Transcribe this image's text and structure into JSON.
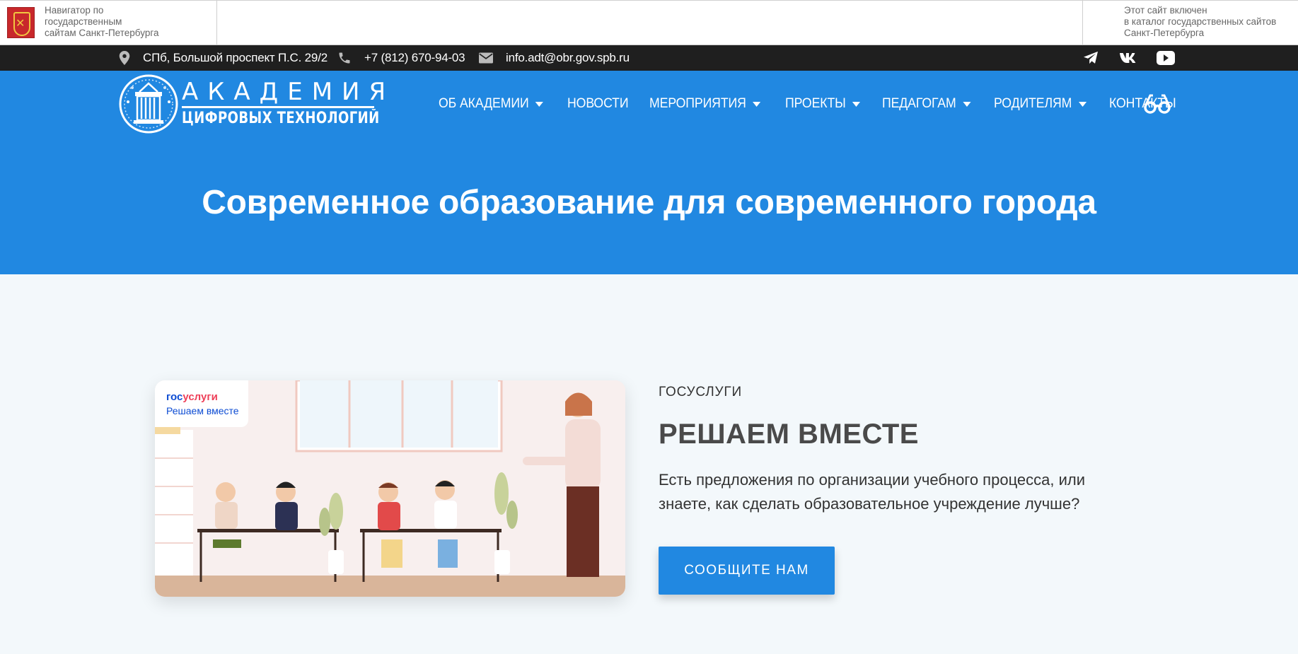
{
  "gov_banner": {
    "left_text": "Навигатор по\nгосударственным\nсайтам Санкт-Петербурга",
    "right_text": "Этот сайт включен\nв каталог государственных сайтов\nСанкт-Петербурга"
  },
  "contacts": {
    "address": "СПб, Большой проспект П.С. 29/2",
    "phone": "+7 (812) 670-94-03",
    "email": "info.adt@obr.gov.spb.ru",
    "social": [
      "telegram-icon",
      "vk-icon",
      "youtube-icon"
    ]
  },
  "logo": {
    "title": "АКАДЕМИЯ",
    "subtitle": "ЦИФРОВЫХ ТЕХНОЛОГИЙ"
  },
  "nav": [
    {
      "label": "ОБ АКАДЕМИИ",
      "dropdown": true
    },
    {
      "label": "НОВОСТИ",
      "dropdown": false
    },
    {
      "label": "МЕРОПРИЯТИЯ",
      "dropdown": true
    },
    {
      "label": "ПРОЕКТЫ",
      "dropdown": true
    },
    {
      "label": "ПЕДАГОГАМ",
      "dropdown": true
    },
    {
      "label": "РОДИТЕЛЯМ",
      "dropdown": true
    },
    {
      "label": "КОНТАКТЫ",
      "dropdown": false
    }
  ],
  "hero": {
    "title": "Современное образование для современного города"
  },
  "gosuslugi": {
    "badge_part1": "гос",
    "badge_part2": "услуги",
    "badge_line2": "Решаем вместе",
    "kicker": "ГОСУСЛУГИ",
    "title": "РЕШАЕМ ВМЕСТЕ",
    "text": "Есть предложения по организации учебного процесса, или знаете, как сделать образовательное учреждение лучше?",
    "button": "СООБЩИТЕ НАМ"
  },
  "colors": {
    "primary": "#2188e1",
    "dark_bar": "#1f1f1f",
    "page_bg": "#f3f8fb",
    "gos_blue": "#0d4cd3",
    "gos_red": "#ee3f58"
  }
}
